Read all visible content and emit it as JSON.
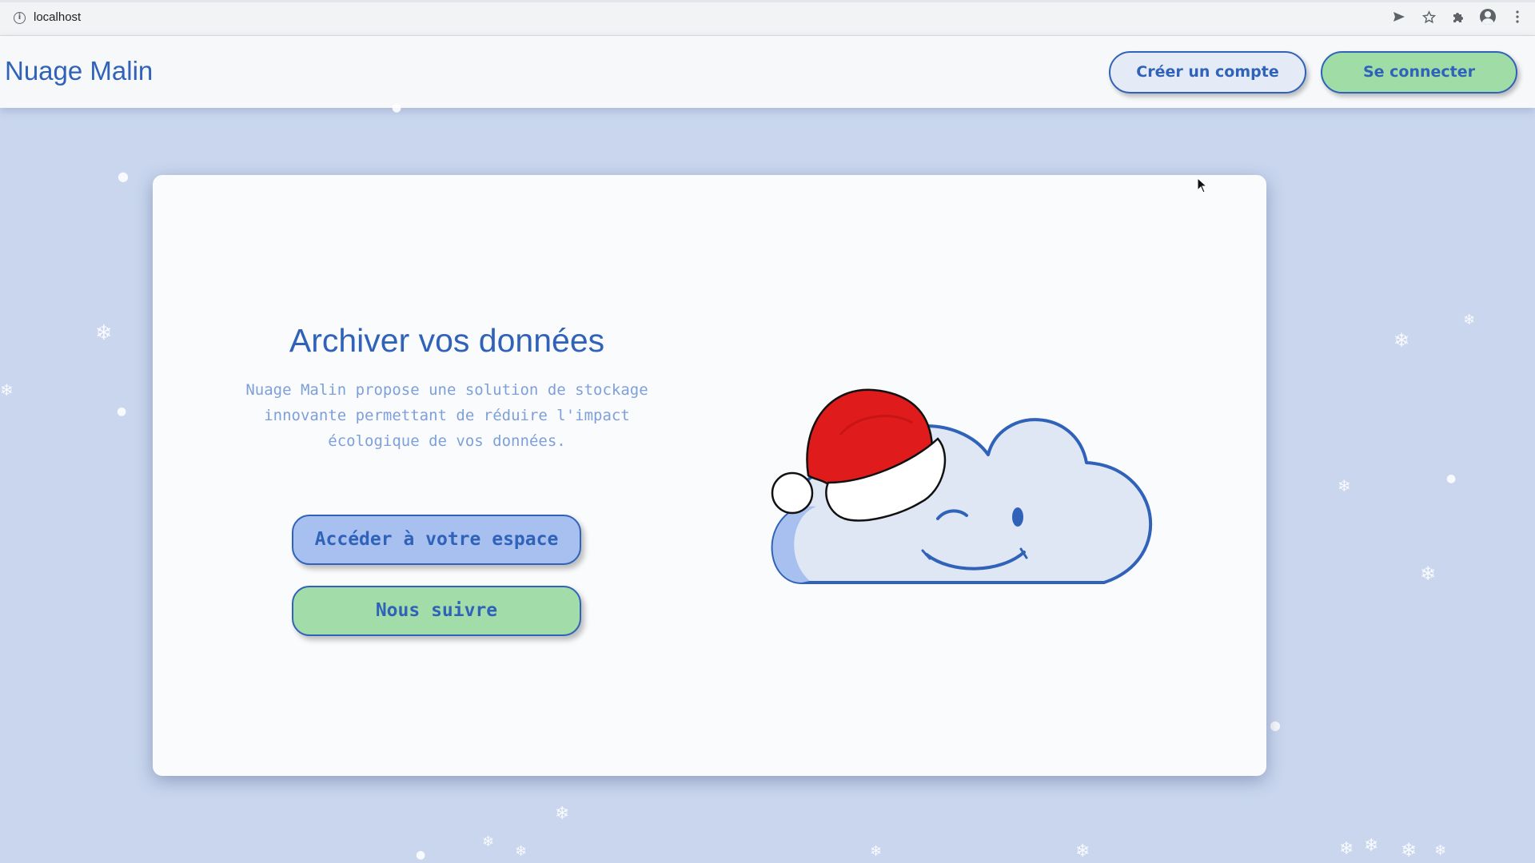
{
  "browser": {
    "url": "localhost",
    "icons": [
      "info-icon",
      "send-icon",
      "star-icon",
      "puzzle-icon",
      "profile-icon",
      "kebab-menu-icon"
    ]
  },
  "header": {
    "brand": "Nuage Malin",
    "create_account_label": "Créer un compte",
    "login_label": "Se connecter"
  },
  "hero": {
    "title": "Archiver vos données",
    "description_lines": [
      "Nuage Malin propose une solution de stockage",
      "innovante permettant de réduire l'impact",
      "écologique de vos données."
    ],
    "primary_button": "Accéder à votre espace",
    "secondary_button": "Nous suivre"
  },
  "colors": {
    "brand_blue": "#2f62b8",
    "light_blue": "#a7c0f0",
    "green": "#a2dca8",
    "background": "#c9d6ee",
    "card": "#fafbfc",
    "hat_red": "#e01b1b"
  },
  "decorations": {
    "mascot": "cloud-with-santa-hat-icon",
    "snow": "snowflake-icon"
  }
}
